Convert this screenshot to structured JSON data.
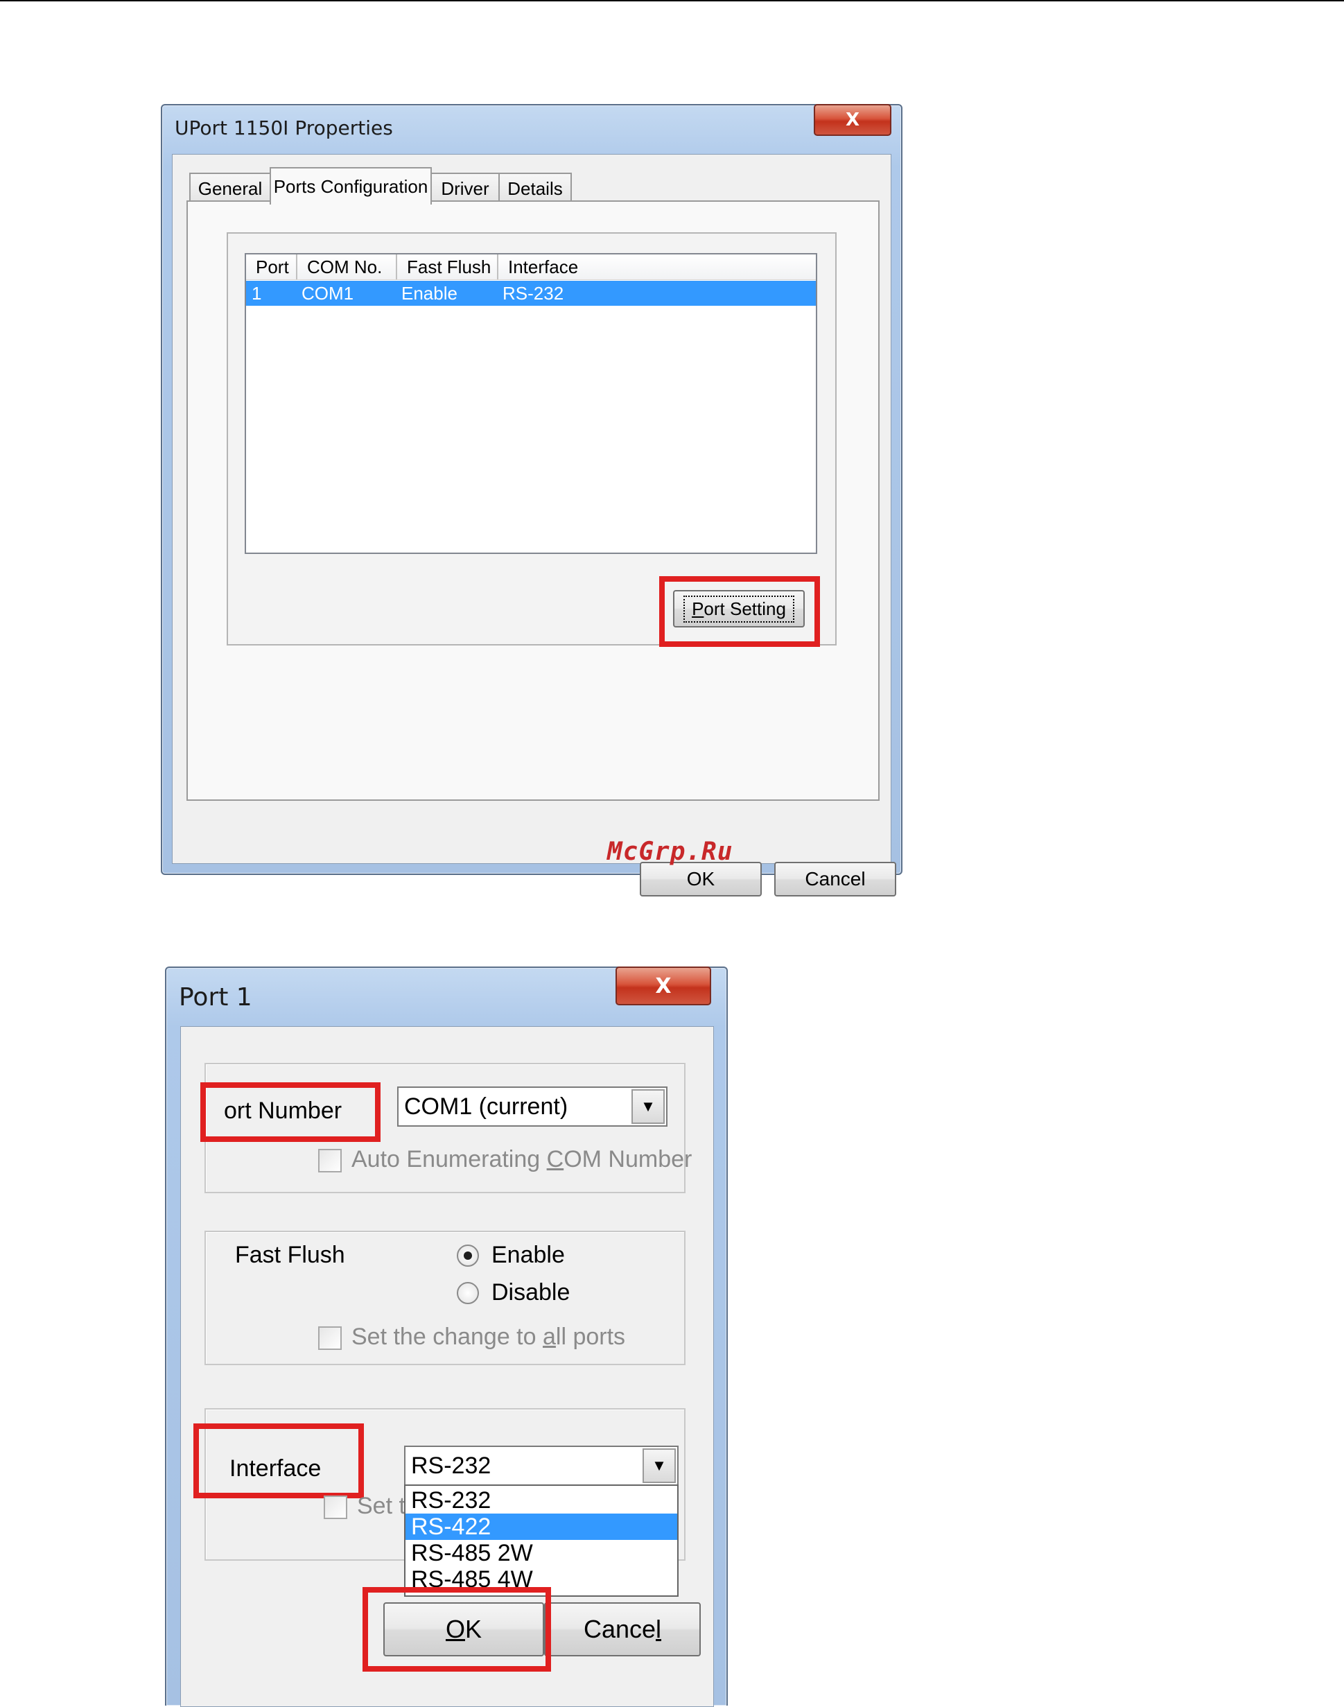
{
  "window1": {
    "title": "UPort 1150I Properties",
    "close_label": "X",
    "tabs": [
      {
        "label": "General"
      },
      {
        "label": "Ports Configuration"
      },
      {
        "label": "Driver"
      },
      {
        "label": "Details"
      }
    ],
    "active_tab": "Ports Configuration",
    "table": {
      "columns": [
        "Port",
        "COM No.",
        "Fast Flush",
        "Interface"
      ],
      "rows": [
        {
          "port": "1",
          "com": "COM1",
          "fast_flush": "Enable",
          "interface": "RS-232"
        }
      ]
    },
    "port_setting_button": {
      "accel": "P",
      "rest": "ort Setting"
    },
    "ok_label": "OK",
    "cancel_label": "Cancel"
  },
  "watermark": "McGrp.Ru",
  "window2": {
    "title": "Port 1",
    "close_label": "X",
    "port_number": {
      "label_accel": "P",
      "label_rest": "ort Number",
      "value": "COM1 (current)"
    },
    "auto_enum": {
      "before": "Auto Enumerating ",
      "accel": "C",
      "after": "OM Number"
    },
    "fast_flush": {
      "label": "Fast Flush",
      "options": [
        "Enable",
        "Disable"
      ],
      "selected": "Enable"
    },
    "set_all_fast": {
      "before": "Set the change to ",
      "accel": "a",
      "after": "ll ports"
    },
    "interface": {
      "label": "Interface",
      "value": "RS-232",
      "options": [
        "RS-232",
        "RS-422",
        "RS-485 2W",
        "RS-485 4W"
      ],
      "highlighted": "RS-422"
    },
    "set_all_iface_partial": "Set t",
    "ok": {
      "accel": "O",
      "rest": "K"
    },
    "cancel": {
      "before": "Cance",
      "accel": "l"
    }
  },
  "colors": {
    "highlight": "#3399ff",
    "red_annotation": "#e02020",
    "window_frame": "#a6c1e3"
  },
  "icons": {
    "close": "close-icon",
    "combo_arrow": "chevron-down-icon"
  }
}
